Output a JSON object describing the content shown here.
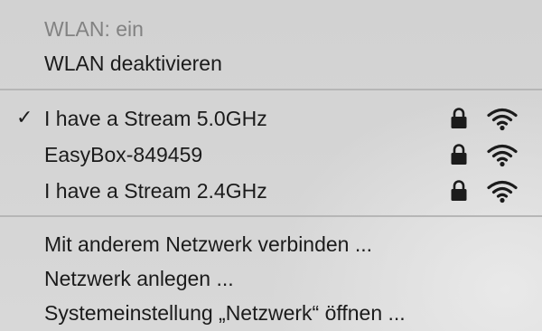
{
  "menu": {
    "status_label": "WLAN: ein",
    "toggle_label": "WLAN deaktivieren",
    "networks": [
      {
        "name": "I have a Stream 5.0GHz",
        "checked": true,
        "secured": true,
        "lock_icon": "lock-icon",
        "signal_icon": "wifi-signal-icon"
      },
      {
        "name": "EasyBox-849459",
        "checked": false,
        "secured": true,
        "lock_icon": "lock-icon",
        "signal_icon": "wifi-signal-icon"
      },
      {
        "name": "I have a Stream 2.4GHz",
        "checked": false,
        "secured": true,
        "lock_icon": "lock-icon",
        "signal_icon": "wifi-signal-icon"
      }
    ],
    "check_mark": "✓",
    "actions": {
      "other_network": "Mit anderem Netzwerk verbinden ...",
      "create_network": "Netzwerk anlegen ...",
      "open_preferences": "Systemeinstellung „Netzwerk“ öffnen ..."
    }
  },
  "colors": {
    "background": "#d4d4d4",
    "text": "#1b1b1b",
    "disabled_text": "#828282",
    "separator": "#b6b6b6"
  }
}
